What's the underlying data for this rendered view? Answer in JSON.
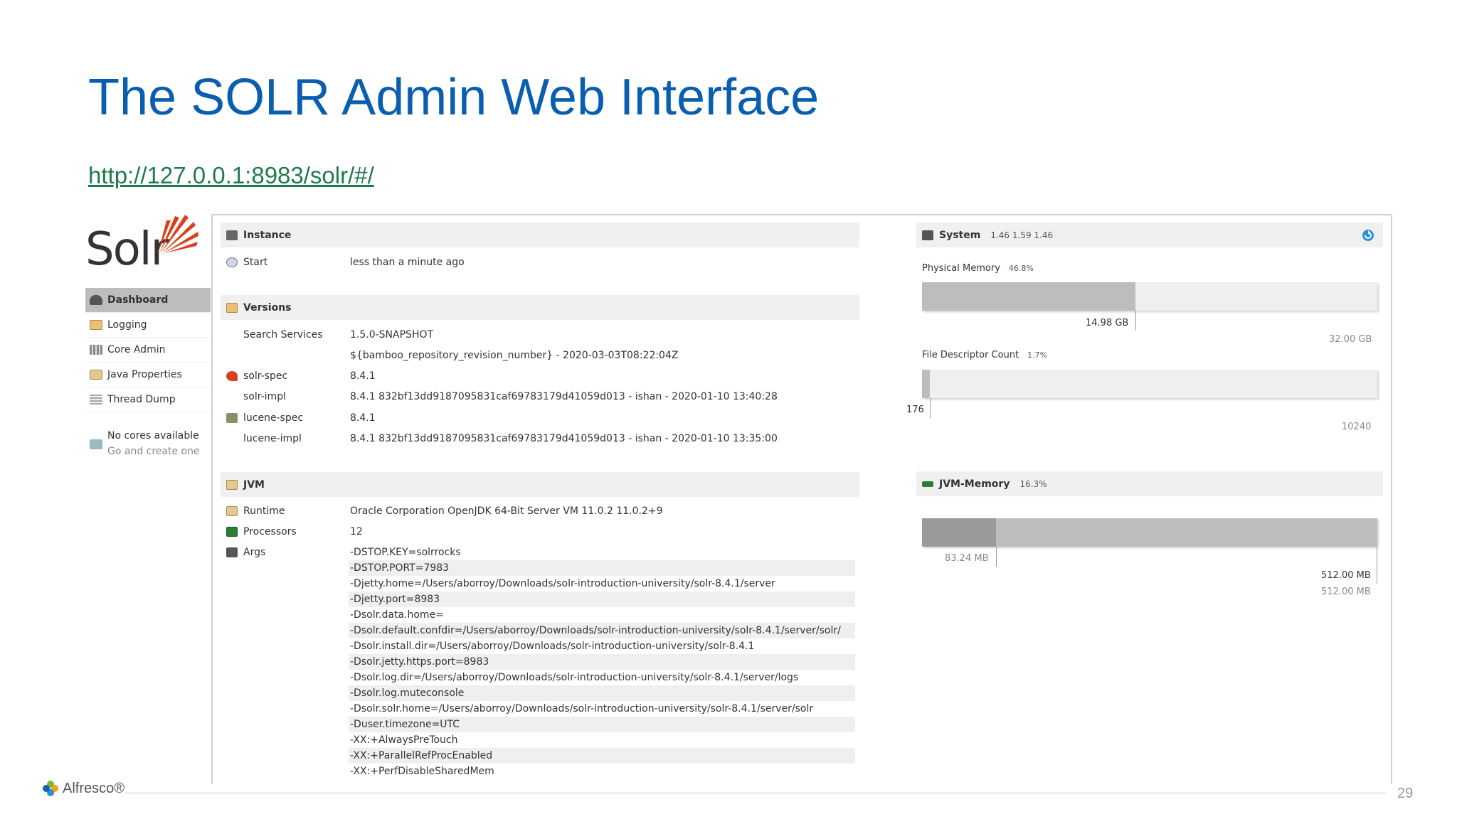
{
  "slide": {
    "title": "The SOLR Admin Web Interface",
    "url": "http://127.0.0.1:8983/solr/#/",
    "page_number": "29",
    "footer_logo": "Alfresco®"
  },
  "logo": {
    "text": "Solr"
  },
  "nav": {
    "items": [
      {
        "label": "Dashboard",
        "icon": "dashboard-icon",
        "active": true
      },
      {
        "label": "Logging",
        "icon": "logging-icon"
      },
      {
        "label": "Core Admin",
        "icon": "core-admin-icon"
      },
      {
        "label": "Java Properties",
        "icon": "java-properties-icon"
      },
      {
        "label": "Thread Dump",
        "icon": "thread-dump-icon"
      }
    ],
    "no_cores": "No cores available",
    "create_one": "Go and create one"
  },
  "instance": {
    "title": "Instance",
    "start_label": "Start",
    "start_value": "less than a minute ago"
  },
  "versions": {
    "title": "Versions",
    "rows": [
      {
        "label": "Search Services",
        "value": "1.5.0-SNAPSHOT"
      },
      {
        "label": "",
        "value": "${bamboo_repository_revision_number} - 2020-03-03T08:22:04Z"
      },
      {
        "label": "solr-spec",
        "value": "8.4.1"
      },
      {
        "label": "solr-impl",
        "value": "8.4.1 832bf13dd9187095831caf69783179d41059d013 - ishan - 2020-01-10 13:40:28"
      },
      {
        "label": "lucene-spec",
        "value": "8.4.1"
      },
      {
        "label": "lucene-impl",
        "value": "8.4.1 832bf13dd9187095831caf69783179d41059d013 - ishan - 2020-01-10 13:35:00"
      }
    ]
  },
  "jvm": {
    "title": "JVM",
    "runtime_label": "Runtime",
    "runtime_value": "Oracle Corporation OpenJDK 64-Bit Server VM 11.0.2 11.0.2+9",
    "processors_label": "Processors",
    "processors_value": "12",
    "args_label": "Args",
    "args": [
      "-DSTOP.KEY=solrrocks",
      "-DSTOP.PORT=7983",
      "-Djetty.home=/Users/aborroy/Downloads/solr-introduction-university/solr-8.4.1/server",
      "-Djetty.port=8983",
      "-Dsolr.data.home=",
      "-Dsolr.default.confdir=/Users/aborroy/Downloads/solr-introduction-university/solr-8.4.1/server/solr/",
      "-Dsolr.install.dir=/Users/aborroy/Downloads/solr-introduction-university/solr-8.4.1",
      "-Dsolr.jetty.https.port=8983",
      "-Dsolr.log.dir=/Users/aborroy/Downloads/solr-introduction-university/solr-8.4.1/server/logs",
      "-Dsolr.log.muteconsole",
      "-Dsolr.solr.home=/Users/aborroy/Downloads/solr-introduction-university/solr-8.4.1/server/solr",
      "-Duser.timezone=UTC",
      "-XX:+AlwaysPreTouch",
      "-XX:+ParallelRefProcEnabled",
      "-XX:+PerfDisableSharedMem"
    ]
  },
  "system": {
    "title": "System",
    "load": "1.46 1.59 1.46",
    "physical_memory": {
      "label": "Physical Memory",
      "percent": "46.8%",
      "used": "14.98 GB",
      "total": "32.00 GB",
      "fraction": 0.468
    },
    "file_descriptors": {
      "label": "File Descriptor Count",
      "percent": "1.7%",
      "used": "176",
      "total": "10240",
      "fraction": 0.017
    }
  },
  "jvm_memory": {
    "title": "JVM-Memory",
    "percent": "16.3%",
    "used": "83.24 MB",
    "committed": "512.00 MB",
    "max": "512.00 MB",
    "fraction": 0.163
  },
  "colors": {
    "title_blue": "#0a5eb0",
    "link_green": "#1f7a4d",
    "solr_red": "#d9411e",
    "refresh_blue": "#2a8fd8"
  }
}
